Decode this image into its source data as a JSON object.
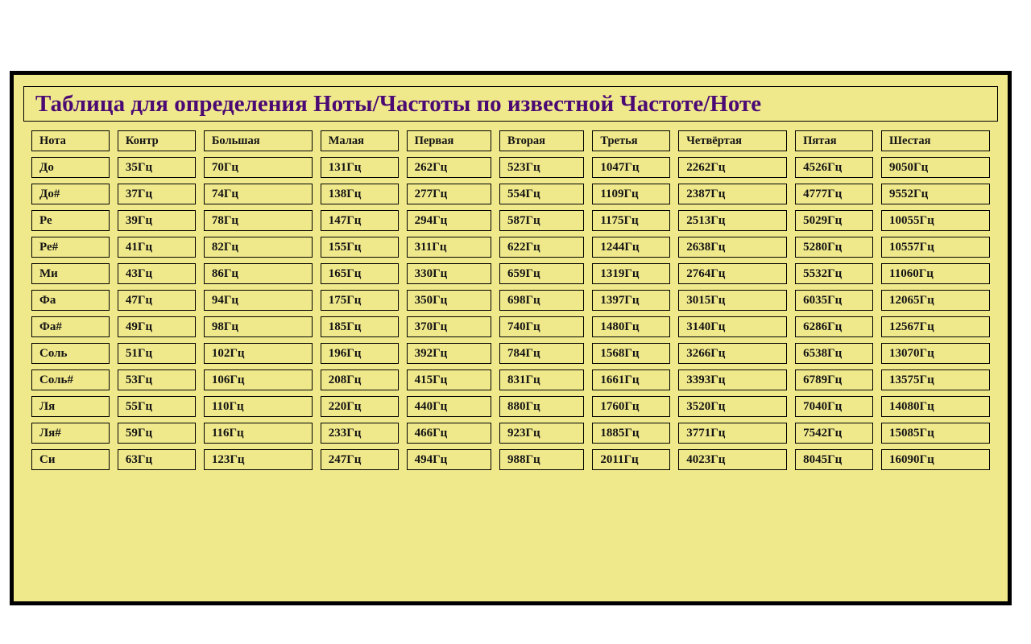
{
  "page": {
    "background_color": "#ffffff",
    "panel_color": "#f0e98c",
    "frame_color": "#000000",
    "title_color": "#4b0a73",
    "text_color": "#141414"
  },
  "title": "Таблица для определения Ноты/Частоты по известной Частоте/Ноте",
  "table": {
    "headers": [
      "Нота",
      "Контр",
      "Большая",
      "Малая",
      "Первая",
      "Вторая",
      "Третья",
      "Четвёртая",
      "Пятая",
      "Шестая"
    ],
    "rows": [
      [
        "До",
        "35Гц",
        "70Гц",
        "131Гц",
        "262Гц",
        "523Гц",
        "1047Гц",
        "2262Гц",
        "4526Гц",
        "9050Гц"
      ],
      [
        "До#",
        "37Гц",
        "74Гц",
        "138Гц",
        "277Гц",
        "554Гц",
        "1109Гц",
        "2387Гц",
        "4777Гц",
        "9552Гц"
      ],
      [
        "Ре",
        "39Гц",
        "78Гц",
        "147Гц",
        "294Гц",
        "587Гц",
        "1175Гц",
        "2513Гц",
        "5029Гц",
        "10055Гц"
      ],
      [
        "Ре#",
        "41Гц",
        "82Гц",
        "155Гц",
        "311Гц",
        "622Гц",
        "1244Гц",
        "2638Гц",
        "5280Гц",
        "10557Гц"
      ],
      [
        "Ми",
        "43Гц",
        "86Гц",
        "165Гц",
        "330Гц",
        "659Гц",
        "1319Гц",
        "2764Гц",
        "5532Гц",
        "11060Гц"
      ],
      [
        "Фа",
        "47Гц",
        "94Гц",
        "175Гц",
        "350Гц",
        "698Гц",
        "1397Гц",
        "3015Гц",
        "6035Гц",
        "12065Гц"
      ],
      [
        "Фа#",
        "49Гц",
        "98Гц",
        "185Гц",
        "370Гц",
        "740Гц",
        "1480Гц",
        "3140Гц",
        "6286Гц",
        "12567Гц"
      ],
      [
        "Соль",
        "51Гц",
        "102Гц",
        "196Гц",
        "392Гц",
        "784Гц",
        "1568Гц",
        "3266Гц",
        "6538Гц",
        "13070Гц"
      ],
      [
        "Соль#",
        "53Гц",
        "106Гц",
        "208Гц",
        "415Гц",
        "831Гц",
        "1661Гц",
        "3393Гц",
        "6789Гц",
        "13575Гц"
      ],
      [
        "Ля",
        "55Гц",
        "110Гц",
        "220Гц",
        "440Гц",
        "880Гц",
        "1760Гц",
        "3520Гц",
        "7040Гц",
        "14080Гц"
      ],
      [
        "Ля#",
        "59Гц",
        "116Гц",
        "233Гц",
        "466Гц",
        "923Гц",
        "1885Гц",
        "3771Гц",
        "7542Гц",
        "15085Гц"
      ],
      [
        "Си",
        "63Гц",
        "123Гц",
        "247Гц",
        "494Гц",
        "988Гц",
        "2011Гц",
        "4023Гц",
        "8045Гц",
        "16090Гц"
      ]
    ]
  }
}
